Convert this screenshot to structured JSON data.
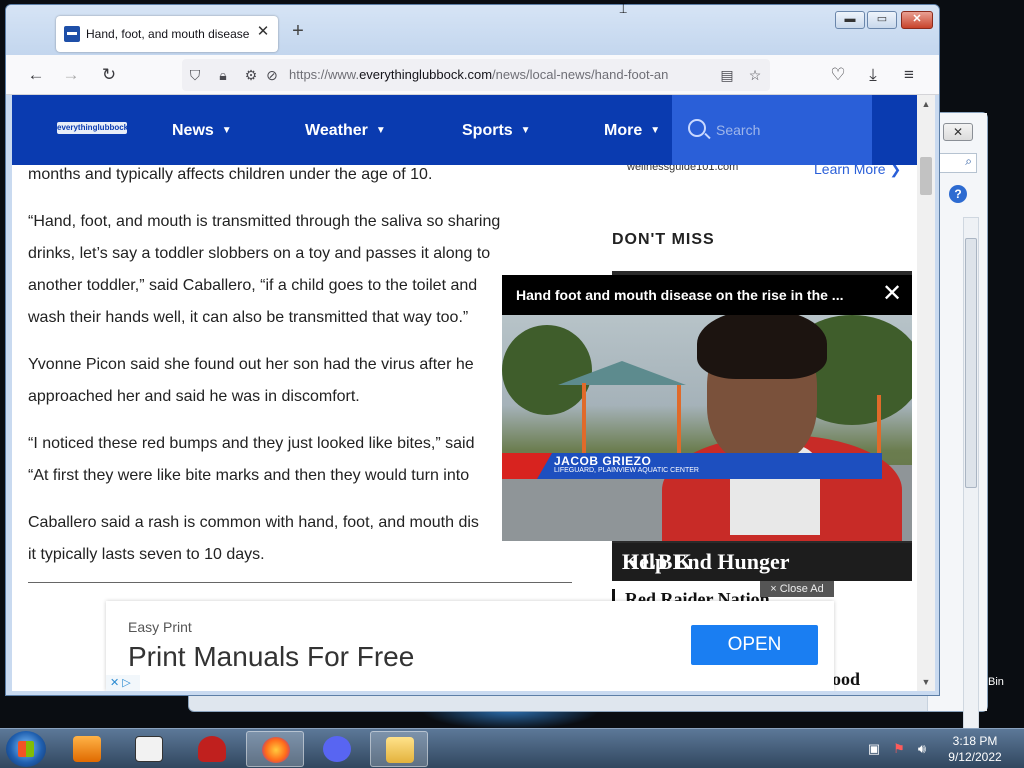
{
  "browser": {
    "tab_title": "Hand, foot, and mouth disease",
    "url_prefix": "https://www.",
    "url_domain": "everythinglubbock.com",
    "url_path": "/news/local-news/hand-foot-an"
  },
  "site_nav": {
    "logo": "everythinglubbock",
    "items": [
      "News",
      "Weather",
      "Sports",
      "More"
    ],
    "search_placeholder": "Search"
  },
  "article": {
    "paragraphs": [
      [
        "months and typically affects children under the age of 10."
      ],
      [
        "“Hand, foot, and mouth is transmitted through the saliva so sharing",
        "drinks, let’s say a toddler slobbers on a toy and passes it along to",
        "another toddler,” said Caballero, “if a child goes to the toilet and",
        "wash their hands well, it can also be transmitted that way too.”"
      ],
      [
        "Yvonne Picon said she found out her son had the virus after he",
        "approached her and said he was in discomfort."
      ],
      [
        "“I noticed these red bumps and they just looked like bites,” said",
        "“At first they were like bite marks and then they would turn into"
      ],
      [
        "Caballero said a rash is common with hand, foot, and mouth dis",
        "it typically lasts seven to 10 days."
      ]
    ]
  },
  "sidebar": {
    "sponsor_source": "wellnessguide101.com",
    "learn_more": "Learn More ❯",
    "section_title": "DON'T MISS",
    "card_headline": "Help End Hunger",
    "card_logo": "KLBK",
    "next_headline": "Red Raider Nation",
    "partial_headline": "ood"
  },
  "video": {
    "title": "Hand foot and mouth disease on the rise in the ...",
    "lower_third_name": "JACOB GRIEZO",
    "lower_third_role": "LIFEGUARD, PLAINVIEW AQUATIC CENTER",
    "close_ad": "× Close Ad"
  },
  "ad": {
    "brand": "Easy Print",
    "headline": "Print Manuals For Free",
    "cta": "OPEN"
  },
  "taskbar": {
    "time": "3:18 PM",
    "date": "9/12/2022",
    "recycle_label": "Bin"
  }
}
